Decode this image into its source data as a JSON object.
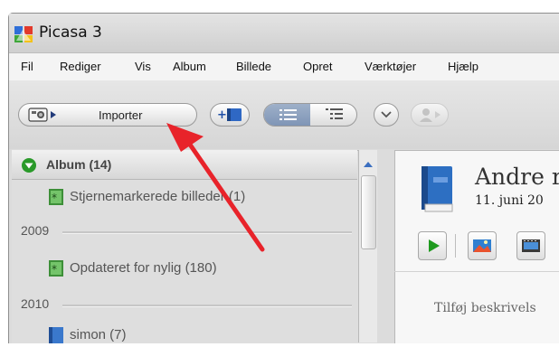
{
  "window": {
    "title": "Picasa 3"
  },
  "menubar": {
    "items": [
      "Fil",
      "Rediger",
      "Vis",
      "Album",
      "Billede",
      "Opret",
      "Værktøjer",
      "Hjælp"
    ]
  },
  "toolbar": {
    "import_label": "Importer"
  },
  "sidebar": {
    "album_header": "Album (14)",
    "items": [
      {
        "label": "Stjernemarkerede billeder (1)",
        "icon": "star-album-icon"
      },
      {
        "label": "2009",
        "type": "year"
      },
      {
        "label": "Opdateret for nylig (180)",
        "icon": "star-album-icon"
      },
      {
        "label": "2010",
        "type": "year"
      },
      {
        "label": "simon (7)",
        "icon": "album-book-icon"
      }
    ]
  },
  "main": {
    "album_title": "Andre r",
    "album_date": "11. juni 20",
    "description_placeholder": "Tilføj beskrivels"
  },
  "colors": {
    "annotation_arrow": "#e8232a",
    "play_green": "#1e9a1e"
  }
}
